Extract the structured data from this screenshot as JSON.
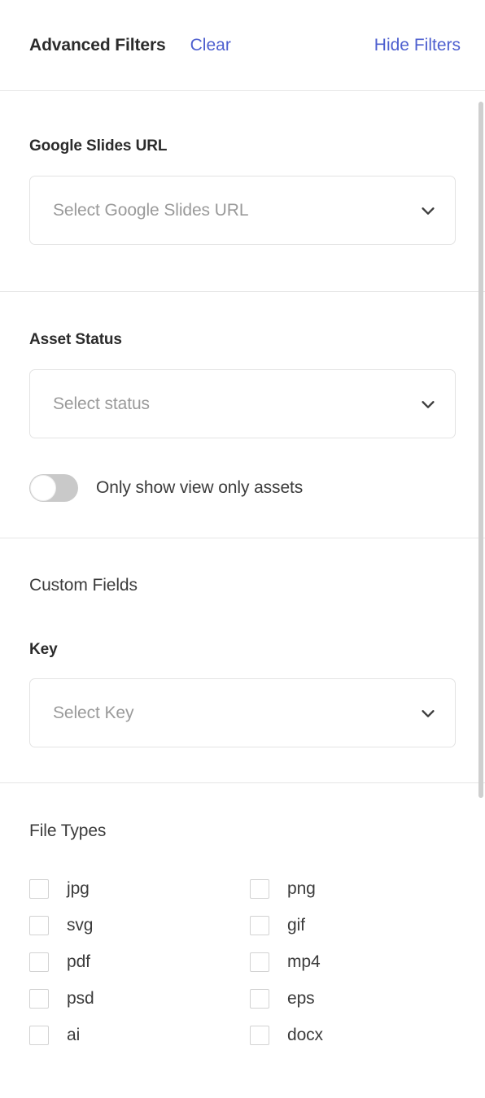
{
  "header": {
    "title": "Advanced Filters",
    "clear_label": "Clear",
    "hide_label": "Hide Filters",
    "link_color": "#4d5fcf",
    "title_color": "#2b2b2b"
  },
  "sections": {
    "google_slides": {
      "label": "Google Slides URL",
      "select_placeholder": "Select Google Slides URL",
      "chevron_icon": "chevron-down-icon"
    },
    "asset_status": {
      "label": "Asset Status",
      "select_placeholder": "Select status",
      "chevron_icon": "chevron-down-icon",
      "toggle": {
        "label": "Only show view only assets",
        "state": "off",
        "track_color": "#c9c9c9",
        "knob_color": "#ffffff"
      }
    },
    "custom_fields": {
      "label": "Custom Fields",
      "key_label": "Key",
      "select_placeholder": "Select Key",
      "chevron_icon": "chevron-down-icon"
    },
    "file_types": {
      "label": "File Types",
      "items": [
        {
          "label": "jpg",
          "checked": false
        },
        {
          "label": "png",
          "checked": false
        },
        {
          "label": "svg",
          "checked": false
        },
        {
          "label": "gif",
          "checked": false
        },
        {
          "label": "pdf",
          "checked": false
        },
        {
          "label": "mp4",
          "checked": false
        },
        {
          "label": "psd",
          "checked": false
        },
        {
          "label": "eps",
          "checked": false
        },
        {
          "label": "ai",
          "checked": false
        },
        {
          "label": "docx",
          "checked": false
        }
      ]
    }
  },
  "scrollbar": {
    "thumb_color": "#cfcfcf"
  }
}
